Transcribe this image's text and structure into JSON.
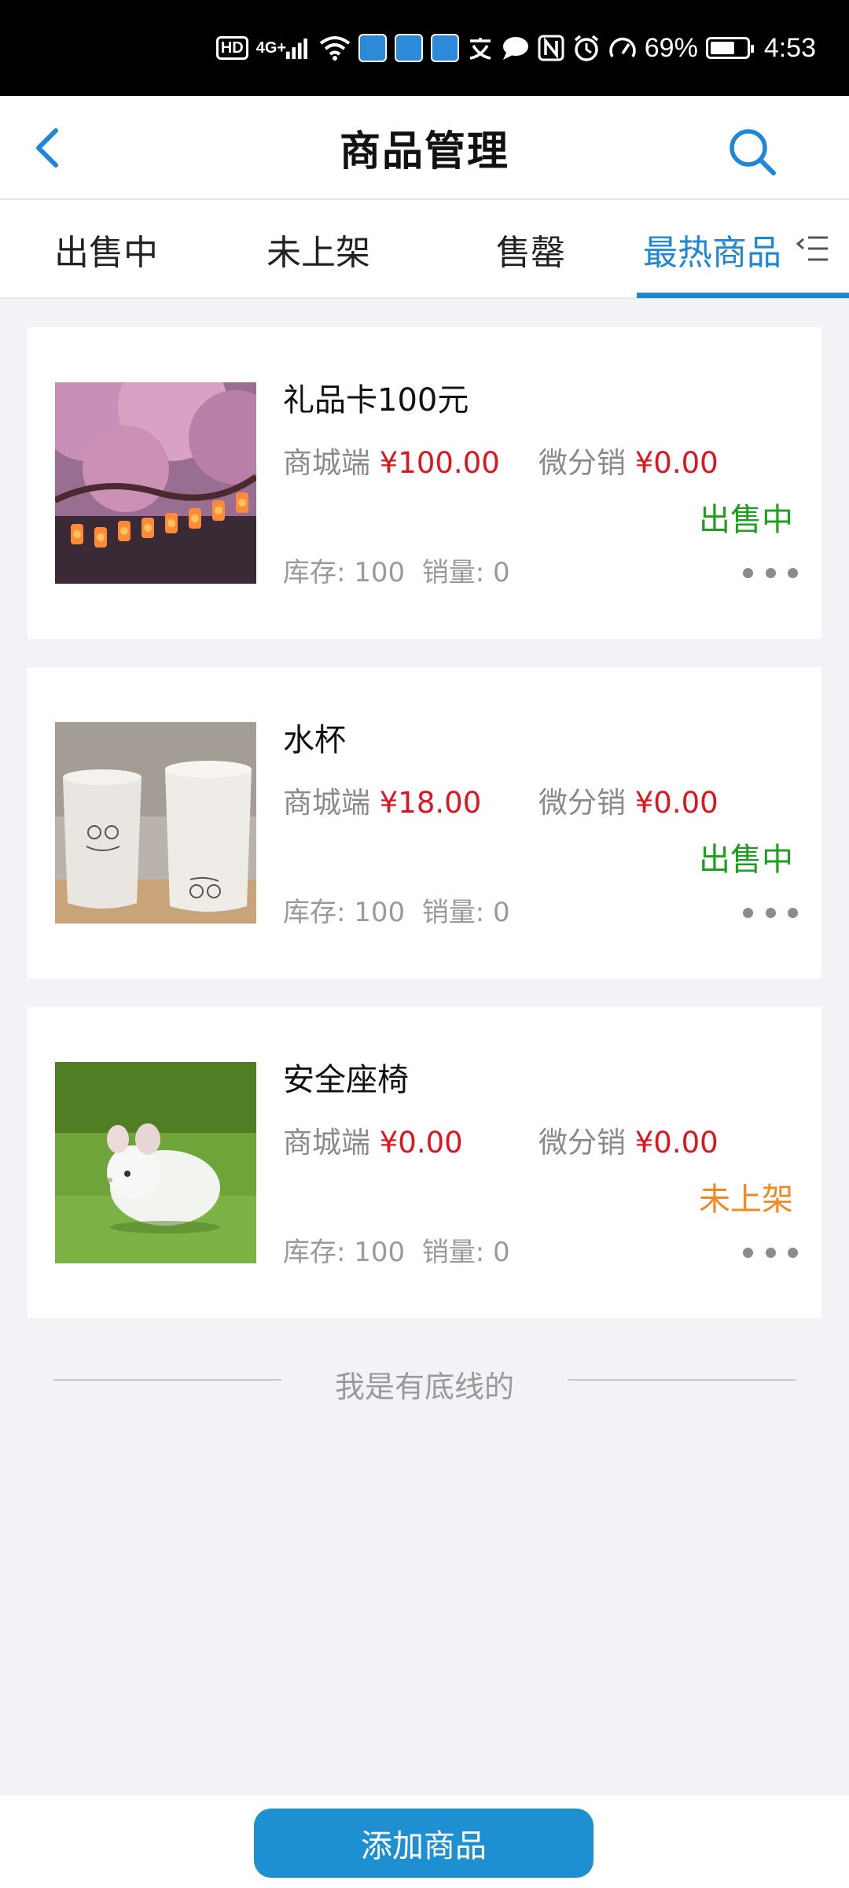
{
  "status_bar": {
    "hd": "HD",
    "network": "4G+",
    "battery_percent": "69%",
    "time": "4:53",
    "icons": [
      "hd-icon",
      "signal-icon",
      "wifi-icon",
      "app-icon",
      "app-icon",
      "app-icon",
      "translate-icon",
      "chat-icon",
      "nfc-icon",
      "alarm-icon",
      "speed-icon",
      "battery-icon"
    ]
  },
  "header": {
    "title": "商品管理"
  },
  "tabs": [
    {
      "label": "出售中"
    },
    {
      "label": "未上架"
    },
    {
      "label": "售罄"
    },
    {
      "label": "最热商品"
    }
  ],
  "active_tab_index": 3,
  "products": [
    {
      "name": "礼品卡100元",
      "mall_label": "商城端",
      "mall_price": "¥100.00",
      "dist_label": "微分销",
      "dist_price": "¥0.00",
      "status": "出售中",
      "stock": "库存: 100",
      "sales": "销量: 0",
      "image": "cherry-blossom-lanterns-photo"
    },
    {
      "name": "水杯",
      "mall_label": "商城端",
      "mall_price": "¥18.00",
      "dist_label": "微分销",
      "dist_price": "¥0.00",
      "status": "出售中",
      "stock": "库存: 100",
      "sales": "销量: 0",
      "image": "two-mugs-photo"
    },
    {
      "name": "安全座椅",
      "mall_label": "商城端",
      "mall_price": "¥0.00",
      "dist_label": "微分销",
      "dist_price": "¥0.00",
      "status": "未上架",
      "stock": "库存: 100",
      "sales": "销量: 0",
      "image": "chinchilla-on-grass-photo"
    }
  ],
  "footer_line": "我是有底线的",
  "add_button_label": "添加商品",
  "colors": {
    "accent": "#1e88d6",
    "price": "#e0141e",
    "status_on": "#1e9f1e",
    "status_off": "#f08a1e",
    "button": "#1e90d2"
  }
}
